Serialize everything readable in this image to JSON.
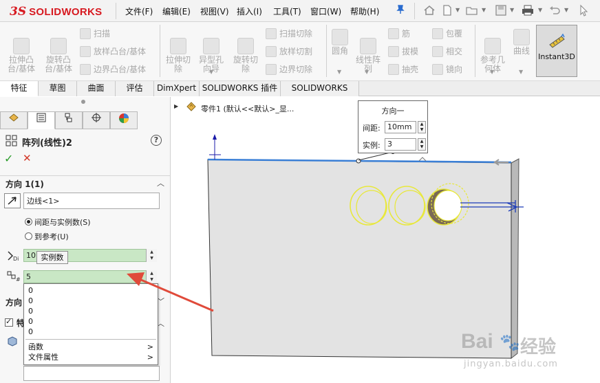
{
  "app": {
    "logo_mark": "3S",
    "logo_text": "SOLIDWORKS"
  },
  "menu": {
    "items": [
      "文件(F)",
      "编辑(E)",
      "视图(V)",
      "插入(I)",
      "工具(T)",
      "窗口(W)",
      "帮助(H)"
    ]
  },
  "toolbar_icons": [
    "pin-icon",
    "home-icon",
    "new-document-icon",
    "open-folder-icon",
    "save-icon",
    "print-icon",
    "undo-icon",
    "select-arrow-icon"
  ],
  "ribbon": {
    "extrude_boss": "拉伸凸\n台/基体",
    "revolve_boss": "旋转凸\n台/基体",
    "sweep": "扫描",
    "loft_boss": "放样凸台/基体",
    "boundary_boss": "边界凸台/基体",
    "extrude_cut": "拉伸切\n除",
    "hole_wizard": "异型孔\n向导",
    "revolve_cut": "旋转切\n除",
    "sweep_cut": "扫描切除",
    "loft_cut": "放样切割",
    "boundary_cut": "边界切除",
    "fillet": "圆角",
    "linear_pattern": "线性阵\n列",
    "rib": "筋",
    "draft": "拔模",
    "shell": "抽壳",
    "wrap": "包覆",
    "intersect": "相交",
    "mirror": "镜向",
    "ref_geometry": "参考几\n何体",
    "curves": "曲线",
    "instant3d": "Instant3D"
  },
  "tabs": [
    "特征",
    "草图",
    "曲面",
    "评估",
    "DimXpert",
    "SOLIDWORKS 插件",
    "SOLIDWORKS MBD"
  ],
  "feature_tree": {
    "part_label": "零件1  (默认<<默认>_显..."
  },
  "property_manager": {
    "title": "阵列(线性)2",
    "ok_symbol": "✓",
    "cancel_symbol": "✕",
    "help_symbol": "?",
    "direction1": {
      "header": "方向 1(1)",
      "edge_value": "边线<1>",
      "radio_spacing": "间距与实例数(S)",
      "radio_reference": "到参考(U)",
      "spacing_value": "10.",
      "instances_value": "5",
      "tooltip": "实例数"
    },
    "direction2_header": "方向",
    "features_header": "特"
  },
  "dropdown": {
    "values": [
      "0",
      "0",
      "0",
      "0",
      "0"
    ],
    "function_label": "函数",
    "file_props_label": "文件属性",
    "arrow": ">"
  },
  "callout": {
    "title": "方向一",
    "spacing_label": "间距:",
    "spacing_value": "10mm",
    "instances_label": "实例:",
    "instances_value": "3"
  },
  "watermark": {
    "brand": "Bai",
    "brand2": "经验",
    "url": "jingyan.baidu.com"
  },
  "colors": {
    "accent_red": "#d71920",
    "field_green": "#c9e7c5",
    "highlight_blue": "#3a7fd6",
    "preview_yellow": "#e8e83a",
    "arrow_red": "#e04a3a",
    "plate": "#e3e3e3"
  }
}
